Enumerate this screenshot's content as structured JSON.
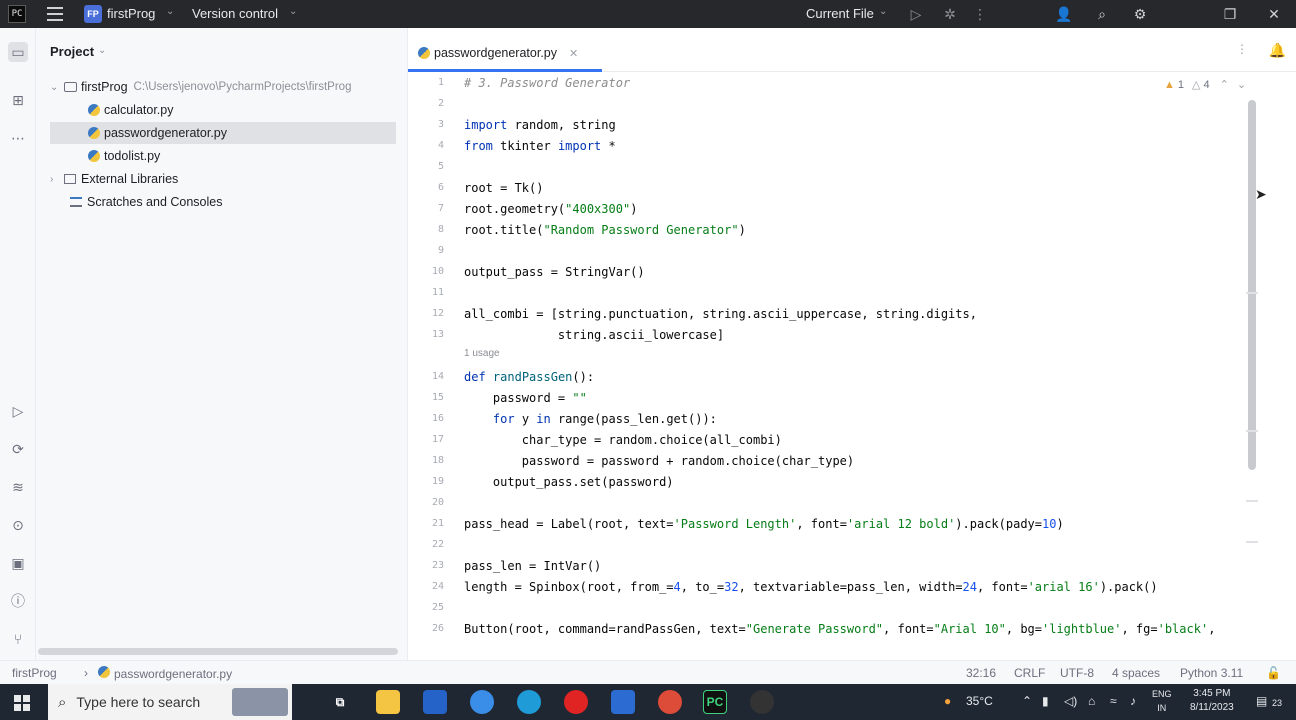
{
  "titlebar": {
    "app_logo": "PC",
    "project_badge": "FP",
    "project_name": "firstProg",
    "vcs_label": "Version control",
    "current_file": "Current File",
    "icons": [
      "hamburger-icon",
      "run-icon",
      "debug-icon",
      "more-icon",
      "account-icon",
      "search-icon",
      "gear-icon",
      "restore-icon",
      "close-icon"
    ]
  },
  "left_strip": {
    "icons": [
      "project-icon",
      "structure-icon",
      "more-icon",
      "run-icon",
      "python-packages-icon",
      "layers-icon",
      "services-icon",
      "terminal-icon",
      "problems-icon",
      "git-icon"
    ]
  },
  "project_panel": {
    "title": "Project",
    "root": {
      "name": "firstProg",
      "path": "C:\\Users\\jenovo\\PycharmProjects\\firstProg"
    },
    "files": [
      "calculator.py",
      "passwordgenerator.py",
      "todolist.py"
    ],
    "selected": "passwordgenerator.py",
    "external": "External Libraries",
    "scratches": "Scratches and Consoles"
  },
  "editor": {
    "tab": "passwordgenerator.py",
    "warnings": "1",
    "weak_warnings": "4",
    "usage_hint": "1 usage",
    "lines": [
      {
        "n": "1",
        "text": "# 3. Password Generator"
      },
      {
        "n": "2",
        "text": ""
      },
      {
        "n": "3",
        "text": "import random, string"
      },
      {
        "n": "4",
        "text": "from tkinter import *"
      },
      {
        "n": "5",
        "text": ""
      },
      {
        "n": "6",
        "text": "root = Tk()"
      },
      {
        "n": "7",
        "text": "root.geometry(\"400x300\")"
      },
      {
        "n": "8",
        "text": "root.title(\"Random Password Generator\")"
      },
      {
        "n": "9",
        "text": ""
      },
      {
        "n": "10",
        "text": "output_pass = StringVar()"
      },
      {
        "n": "11",
        "text": ""
      },
      {
        "n": "12",
        "text": "all_combi = [string.punctuation, string.ascii_uppercase, string.digits,"
      },
      {
        "n": "13",
        "text": "             string.ascii_lowercase]"
      },
      {
        "n": "14",
        "text": "def randPassGen():"
      },
      {
        "n": "15",
        "text": "    password = \"\""
      },
      {
        "n": "16",
        "text": "    for y in range(pass_len.get()):"
      },
      {
        "n": "17",
        "text": "        char_type = random.choice(all_combi)"
      },
      {
        "n": "18",
        "text": "        password = password + random.choice(char_type)"
      },
      {
        "n": "19",
        "text": "    output_pass.set(password)"
      },
      {
        "n": "20",
        "text": ""
      },
      {
        "n": "21",
        "text": "pass_head = Label(root, text='Password Length', font='arial 12 bold').pack(pady=10)"
      },
      {
        "n": "22",
        "text": ""
      },
      {
        "n": "23",
        "text": "pass_len = IntVar()"
      },
      {
        "n": "24",
        "text": "length = Spinbox(root, from_=4, to_=32, textvariable=pass_len, width=24, font='arial 16').pack()"
      },
      {
        "n": "25",
        "text": ""
      },
      {
        "n": "26",
        "text": "Button(root, command=randPassGen, text=\"Generate Password\", font=\"Arial 10\", bg='lightblue', fg='black',"
      }
    ]
  },
  "statusbar": {
    "breadcrumb_project": "firstProg",
    "breadcrumb_file": "passwordgenerator.py",
    "position": "32:16",
    "line_sep": "CRLF",
    "encoding": "UTF-8",
    "indent": "4 spaces",
    "interpreter": "Python 3.11"
  },
  "taskbar": {
    "search_placeholder": "Type here to search",
    "weather": "35°C",
    "lang_top": "ENG",
    "lang_bottom": "IN",
    "time": "3:45 PM",
    "date": "8/11/2023",
    "notif_count": "23"
  }
}
